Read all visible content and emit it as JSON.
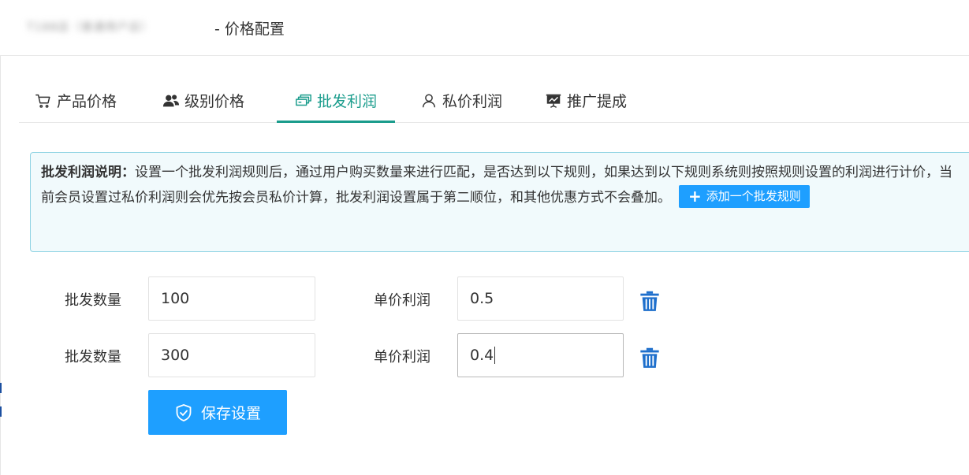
{
  "header": {
    "shop_name": "T188店（普通用户店）",
    "title": "- 价格配置"
  },
  "tabs": [
    {
      "label": "产品价格",
      "icon": "cart-icon"
    },
    {
      "label": "级别价格",
      "icon": "users-icon"
    },
    {
      "label": "批发利润",
      "icon": "wholesale-icon",
      "active": true
    },
    {
      "label": "私价利润",
      "icon": "user-icon"
    },
    {
      "label": "推广提成",
      "icon": "presentation-icon"
    }
  ],
  "info": {
    "title": "批发利润说明：",
    "text": "设置一个批发利润规则后，通过用户购买数量来进行匹配，是否达到以下规则，如果达到以下规则系统则按照规则设置的利润进行计价，当前会员设置过私价利润则会优先按会员私价计算，批发利润设置属于第二顺位，和其他优惠方式不会叠加。",
    "add_button": "添加一个批发规则"
  },
  "rules": [
    {
      "qty_label": "批发数量",
      "qty_value": "100",
      "profit_label": "单价利润",
      "profit_value": "0.5"
    },
    {
      "qty_label": "批发数量",
      "qty_value": "300",
      "profit_label": "单价利润",
      "profit_value": "0.4"
    }
  ],
  "save_button": "保存设置",
  "colors": {
    "accent": "#1a9c8c",
    "primary": "#1e9fff",
    "info_bg": "#f1fafc",
    "info_border": "#8fd3e3"
  }
}
